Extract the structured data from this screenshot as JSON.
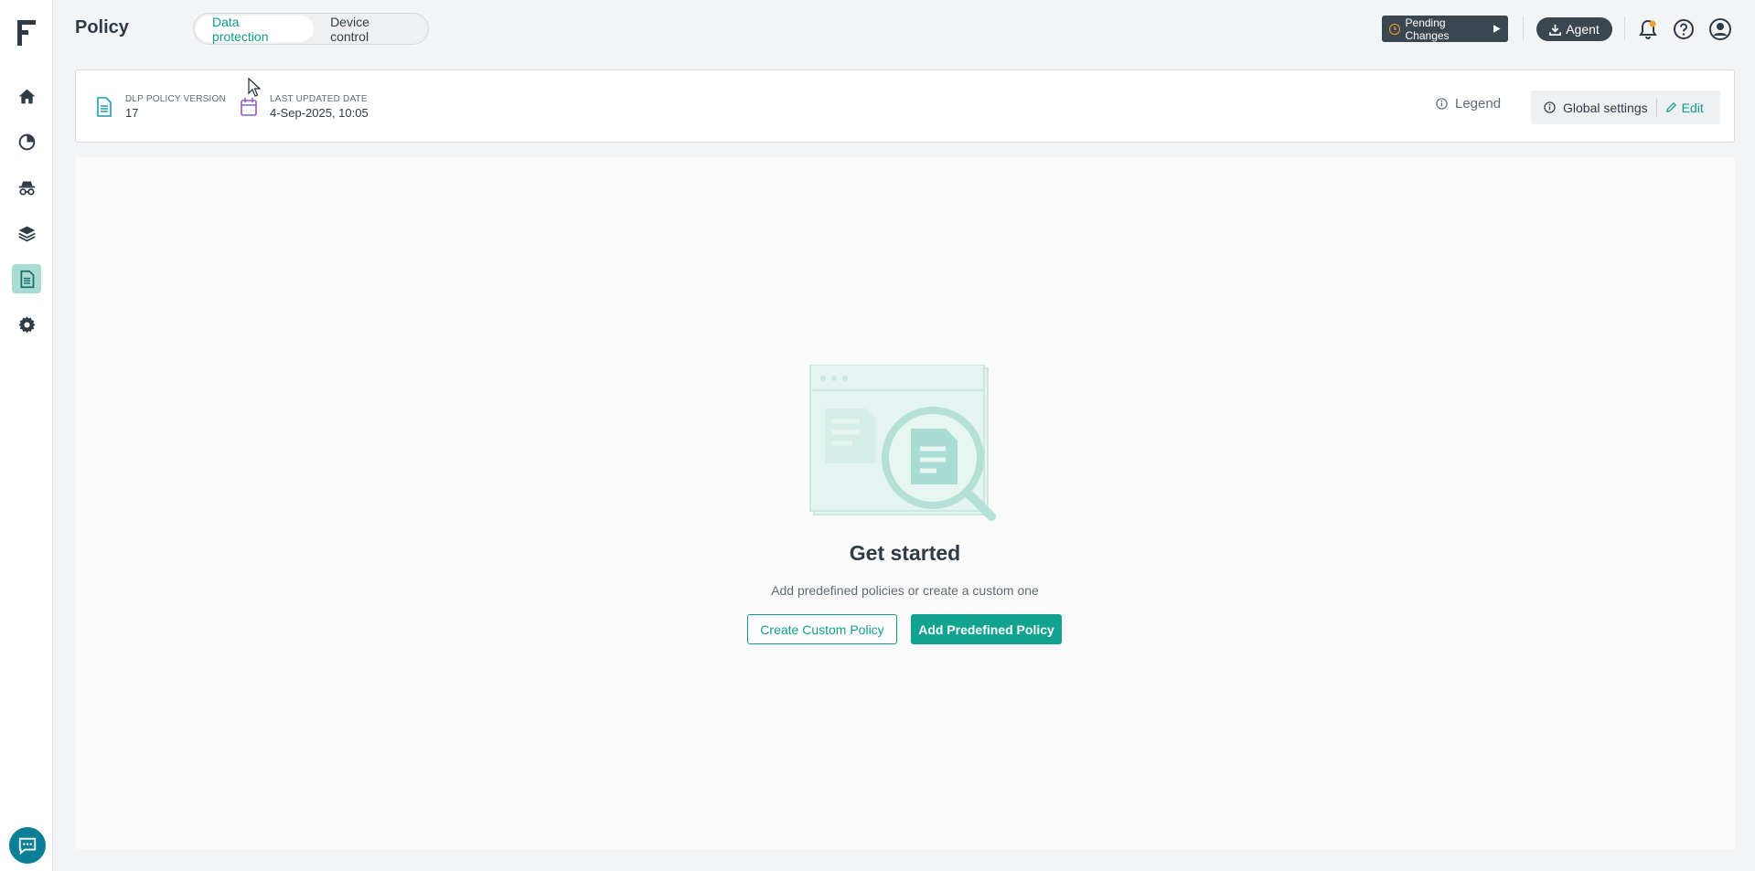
{
  "app": {
    "page_title": "Policy"
  },
  "tabs": [
    {
      "label": "Data protection",
      "active": true
    },
    {
      "label": "Device control",
      "active": false
    }
  ],
  "sidebar": {
    "items": [
      {
        "icon": "home-icon",
        "active": false
      },
      {
        "icon": "pie-chart-icon",
        "active": false
      },
      {
        "icon": "spy-icon",
        "active": false
      },
      {
        "icon": "layers-icon",
        "active": false
      },
      {
        "icon": "document-icon",
        "active": true
      },
      {
        "icon": "gear-icon",
        "active": false
      }
    ]
  },
  "header": {
    "pending_label": "Pending Changes",
    "agent_label": "Agent"
  },
  "info": {
    "version_label": "DLP POLICY VERSION",
    "version_value": "17",
    "updated_label": "LAST UPDATED DATE",
    "updated_value": "4-Sep-2025, 10:05",
    "legend_label": "Legend",
    "global_settings_label": "Global settings",
    "edit_label": "Edit"
  },
  "empty_state": {
    "title": "Get started",
    "subtitle": "Add predefined policies or create a custom one",
    "create_custom_label": "Create Custom Policy",
    "add_predefined_label": "Add Predefined Policy"
  },
  "colors": {
    "accent": "#10a38f",
    "dark_button": "#3a4650",
    "chat": "#0a7f96",
    "active_nav": "#a9dcd4",
    "notification_dot": "#f0a030"
  }
}
